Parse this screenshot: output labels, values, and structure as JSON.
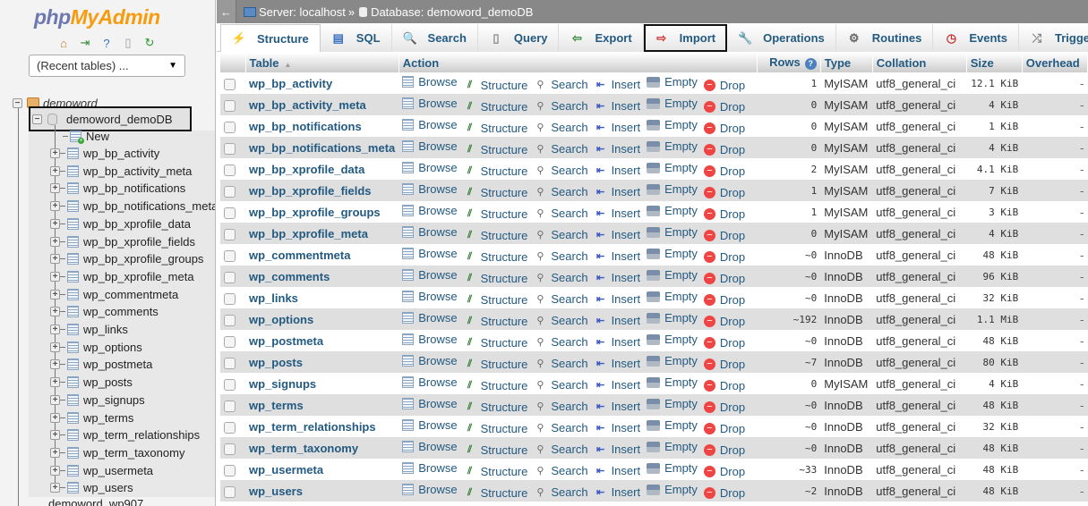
{
  "sidebar": {
    "logo_php": "php",
    "logo_myadmin": "MyAdmin",
    "nav_icons": [
      "home-icon",
      "logout-icon",
      "help-icon",
      "docs-icon",
      "reload-icon"
    ],
    "recent_tables": "(Recent tables) ...",
    "root": "demoword",
    "selected_db": "demoword_demoDB",
    "new_label": "New",
    "tables": [
      "wp_bp_activity",
      "wp_bp_activity_meta",
      "wp_bp_notifications",
      "wp_bp_notifications_meta",
      "wp_bp_xprofile_data",
      "wp_bp_xprofile_fields",
      "wp_bp_xprofile_groups",
      "wp_bp_xprofile_meta",
      "wp_commentmeta",
      "wp_comments",
      "wp_links",
      "wp_options",
      "wp_postmeta",
      "wp_posts",
      "wp_signups",
      "wp_terms",
      "wp_term_relationships",
      "wp_term_taxonomy",
      "wp_usermeta",
      "wp_users"
    ],
    "next_db": "demoword_wp907"
  },
  "breadcrumb": {
    "server": "Server: localhost",
    "separator": "»",
    "database": "Database: demoword_demoDB"
  },
  "tabs": [
    {
      "label": "Structure",
      "icon": "structure-icon",
      "glyph": "⚡"
    },
    {
      "label": "SQL",
      "icon": "sql-icon",
      "glyph": "▤"
    },
    {
      "label": "Search",
      "icon": "search-icon",
      "glyph": "🔍"
    },
    {
      "label": "Query",
      "icon": "query-icon",
      "glyph": "▯"
    },
    {
      "label": "Export",
      "icon": "export-icon",
      "glyph": "⇦"
    },
    {
      "label": "Import",
      "icon": "import-icon",
      "glyph": "⇨"
    },
    {
      "label": "Operations",
      "icon": "wrench-icon",
      "glyph": "🔧"
    },
    {
      "label": "Routines",
      "icon": "gears-icon",
      "glyph": "⚙"
    },
    {
      "label": "Events",
      "icon": "clock-icon",
      "glyph": "◷"
    },
    {
      "label": "Triggers",
      "icon": "triggers-icon",
      "glyph": "⤮"
    }
  ],
  "table": {
    "headers": {
      "table": "Table",
      "action": "Action",
      "rows": "Rows",
      "type": "Type",
      "collation": "Collation",
      "size": "Size",
      "overhead": "Overhead"
    },
    "actions": {
      "browse": "Browse",
      "structure": "Structure",
      "search": "Search",
      "insert": "Insert",
      "empty": "Empty",
      "drop": "Drop"
    },
    "rows": [
      {
        "name": "wp_bp_activity",
        "rows": "1",
        "type": "MyISAM",
        "collation": "utf8_general_ci",
        "size": "12.1 KiB",
        "overhead": "-"
      },
      {
        "name": "wp_bp_activity_meta",
        "rows": "0",
        "type": "MyISAM",
        "collation": "utf8_general_ci",
        "size": "4 KiB",
        "overhead": "-"
      },
      {
        "name": "wp_bp_notifications",
        "rows": "0",
        "type": "MyISAM",
        "collation": "utf8_general_ci",
        "size": "1 KiB",
        "overhead": "-"
      },
      {
        "name": "wp_bp_notifications_meta",
        "rows": "0",
        "type": "MyISAM",
        "collation": "utf8_general_ci",
        "size": "4 KiB",
        "overhead": "-"
      },
      {
        "name": "wp_bp_xprofile_data",
        "rows": "2",
        "type": "MyISAM",
        "collation": "utf8_general_ci",
        "size": "4.1 KiB",
        "overhead": "-"
      },
      {
        "name": "wp_bp_xprofile_fields",
        "rows": "1",
        "type": "MyISAM",
        "collation": "utf8_general_ci",
        "size": "7 KiB",
        "overhead": "-"
      },
      {
        "name": "wp_bp_xprofile_groups",
        "rows": "1",
        "type": "MyISAM",
        "collation": "utf8_general_ci",
        "size": "3 KiB",
        "overhead": "-"
      },
      {
        "name": "wp_bp_xprofile_meta",
        "rows": "0",
        "type": "MyISAM",
        "collation": "utf8_general_ci",
        "size": "4 KiB",
        "overhead": "-"
      },
      {
        "name": "wp_commentmeta",
        "rows": "~0",
        "type": "InnoDB",
        "collation": "utf8_general_ci",
        "size": "48 KiB",
        "overhead": "-"
      },
      {
        "name": "wp_comments",
        "rows": "~0",
        "type": "InnoDB",
        "collation": "utf8_general_ci",
        "size": "96 KiB",
        "overhead": "-"
      },
      {
        "name": "wp_links",
        "rows": "~0",
        "type": "InnoDB",
        "collation": "utf8_general_ci",
        "size": "32 KiB",
        "overhead": "-"
      },
      {
        "name": "wp_options",
        "rows": "~192",
        "type": "InnoDB",
        "collation": "utf8_general_ci",
        "size": "1.1 MiB",
        "overhead": "-"
      },
      {
        "name": "wp_postmeta",
        "rows": "~0",
        "type": "InnoDB",
        "collation": "utf8_general_ci",
        "size": "48 KiB",
        "overhead": "-"
      },
      {
        "name": "wp_posts",
        "rows": "~7",
        "type": "InnoDB",
        "collation": "utf8_general_ci",
        "size": "80 KiB",
        "overhead": "-"
      },
      {
        "name": "wp_signups",
        "rows": "0",
        "type": "MyISAM",
        "collation": "utf8_general_ci",
        "size": "4 KiB",
        "overhead": "-"
      },
      {
        "name": "wp_terms",
        "rows": "~0",
        "type": "InnoDB",
        "collation": "utf8_general_ci",
        "size": "48 KiB",
        "overhead": "-"
      },
      {
        "name": "wp_term_relationships",
        "rows": "~0",
        "type": "InnoDB",
        "collation": "utf8_general_ci",
        "size": "32 KiB",
        "overhead": "-"
      },
      {
        "name": "wp_term_taxonomy",
        "rows": "~0",
        "type": "InnoDB",
        "collation": "utf8_general_ci",
        "size": "48 KiB",
        "overhead": "-"
      },
      {
        "name": "wp_usermeta",
        "rows": "~33",
        "type": "InnoDB",
        "collation": "utf8_general_ci",
        "size": "48 KiB",
        "overhead": "-"
      },
      {
        "name": "wp_users",
        "rows": "~2",
        "type": "InnoDB",
        "collation": "utf8_general_ci",
        "size": "48 KiB",
        "overhead": "-"
      }
    ]
  }
}
